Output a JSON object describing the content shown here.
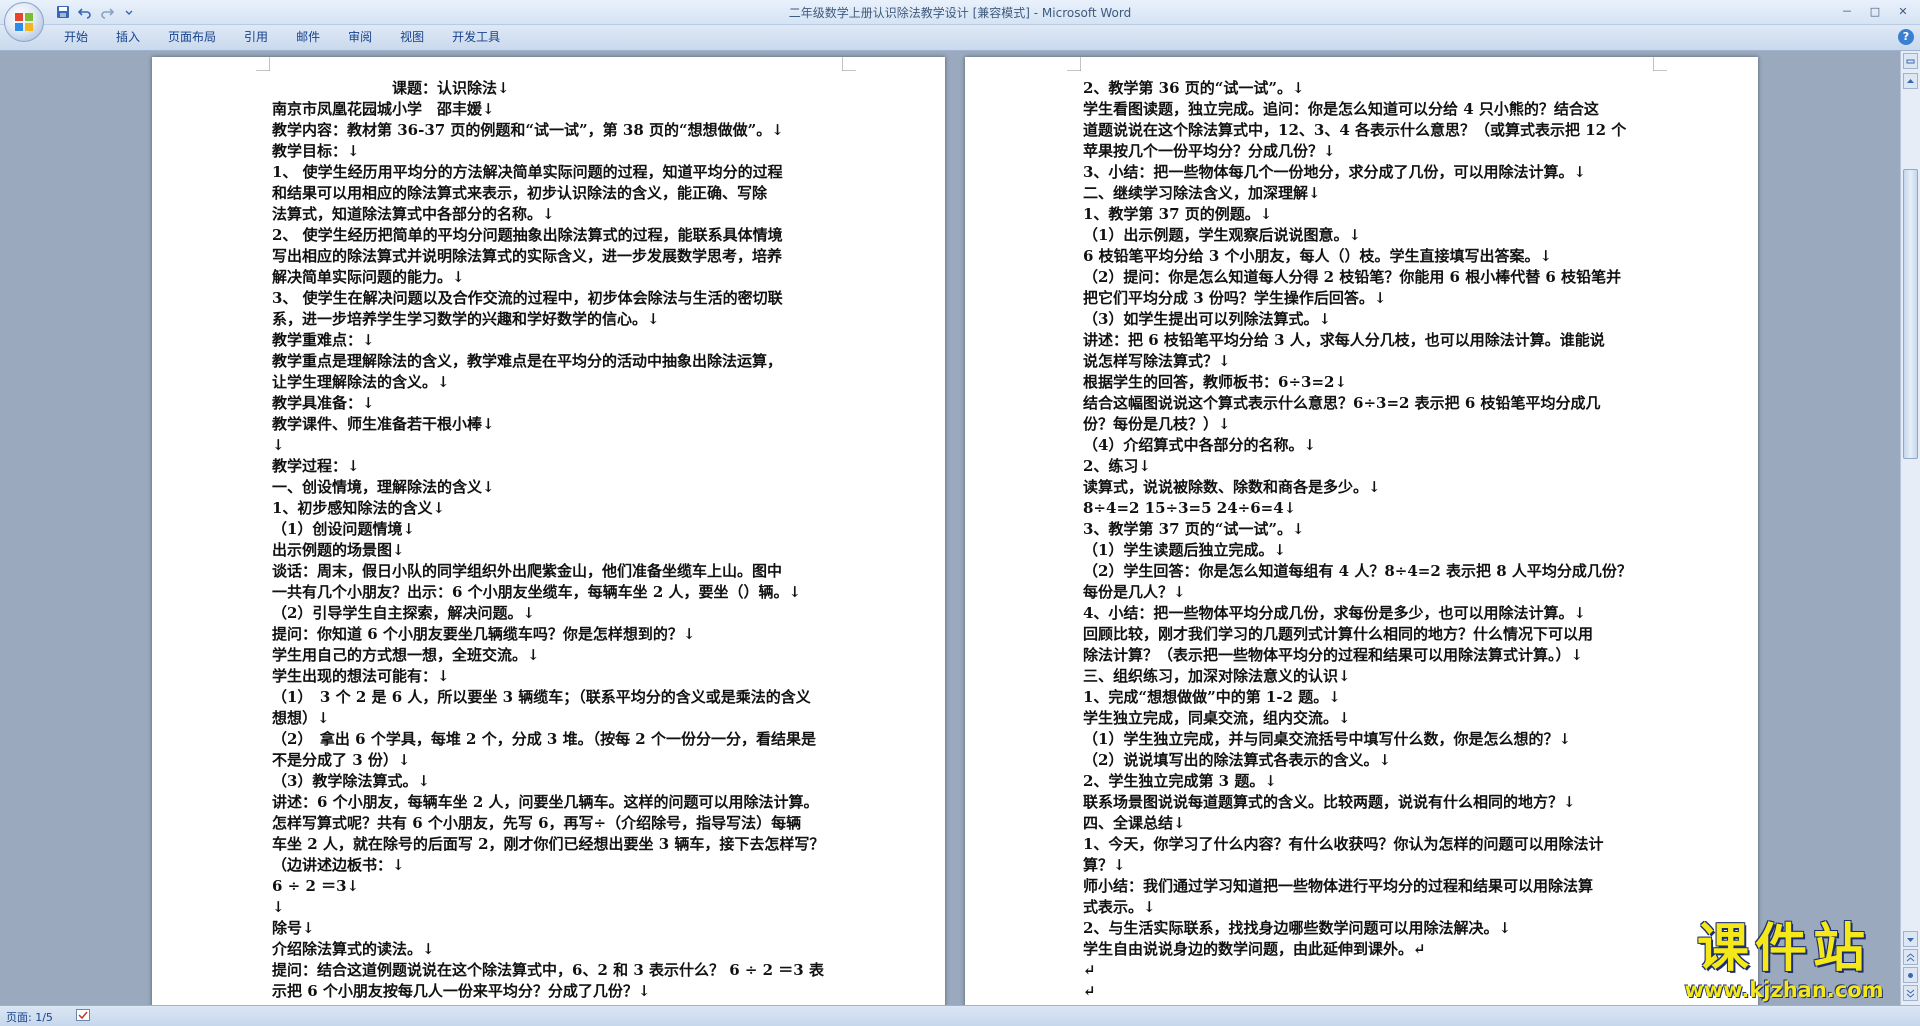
{
  "window": {
    "title": "二年级数学上册认识除法教学设计 [兼容模式] - Microsoft Word",
    "controls": [
      "－",
      "□",
      "✕"
    ]
  },
  "ribbon": {
    "tabs": [
      "开始",
      "插入",
      "页面布局",
      "引用",
      "邮件",
      "审阅",
      "视图",
      "开发工具"
    ],
    "help": "?"
  },
  "page1_lines": [
    "　　　　　　　　课题：认识除法↓",
    "南京市凤凰花园城小学　邵丰媛↓",
    "教学内容：教材第 36-37 页的例题和“试一试”，第 38 页的“想想做做”。↓",
    "教学目标：↓",
    "1、 使学生经历用平均分的方法解决简单实际问题的过程，知道平均分的过程",
    "和结果可以用相应的除法算式来表示，初步认识除法的含义，能正确、写除",
    "法算式，知道除法算式中各部分的名称。↓",
    "2、 使学生经历把简单的平均分问题抽象出除法算式的过程，能联系具体情境",
    "写出相应的除法算式并说明除法算式的实际含义，进一步发展数学思考，培养",
    "解决简单实际问题的能力。↓",
    "3、 使学生在解决问题以及合作交流的过程中，初步体会除法与生活的密切联",
    "系，进一步培养学生学习数学的兴趣和学好数学的信心。↓",
    "教学重难点：↓",
    "教学重点是理解除法的含义，教学难点是在平均分的活动中抽象出除法运算，",
    "让学生理解除法的含义。↓",
    "教学具准备：↓",
    "教学课件、师生准备若干根小棒↓",
    "↓",
    "教学过程：↓",
    "一、创设情境，理解除法的含义↓",
    "1、初步感知除法的含义↓",
    "（1）创设问题情境↓",
    "出示例题的场景图↓",
    "谈话：周末，假日小队的同学组织外出爬紫金山，他们准备坐缆车上山。图中",
    "一共有几个小朋友？出示：6 个小朋友坐缆车，每辆车坐 2 人，要坐（）辆。↓",
    "（2）引导学生自主探索，解决问题。↓",
    "提问：你知道 6 个小朋友要坐几辆缆车吗？你是怎样想到的？↓",
    "学生用自己的方式想一想，全班交流。↓",
    "学生出现的想法可能有：↓",
    "（1）　3 个 2 是 6 人，所以要坐 3 辆缆车；（联系平均分的含义或是乘法的含义",
    "想想）↓",
    "（2）　拿出 6 个学具，每堆 2 个，分成 3 堆。（按每 2 个一份分一分，看结果是",
    "不是分成了 3 份）↓",
    "（3）教学除法算式。↓",
    "讲述：6 个小朋友，每辆车坐 2 人，问要坐几辆车。这样的问题可以用除法计算。",
    "怎样写算式呢？共有 6 个小朋友，先写 6，再写÷（介绍除号，指导写法）每辆",
    "车坐 2 人，就在除号的后面写 2，刚才你们已经想出要坐 3 辆车，接下去怎样写？",
    "（边讲述边板书：↓",
    "6 ÷ 2 ＝3↓",
    "↓",
    "除号↓",
    "介绍除法算式的读法。↓",
    "提问：结合这道例题说说在这个除法算式中，6、2 和 3 表示什么？ 6 ÷ 2 ＝3 表",
    "示把 6 个小朋友按每几人一份来平均分？分成了几份？↓"
  ],
  "page2_lines": [
    "2、教学第 36 页的“试一试”。↓",
    "学生看图读题，独立完成。追问：你是怎么知道可以分给 4 只小熊的？结合这",
    "道题说说在这个除法算式中，12、3、4 各表示什么意思？（或算式表示把 12 个",
    "苹果按几个一份平均分？分成几份？↓",
    "3、小结：把一些物体每几个一份地分，求分成了几份，可以用除法计算。↓",
    "二、继续学习除法含义，加深理解↓",
    "1、教学第 37 页的例题。↓",
    "（1）出示例题，学生观察后说说图意。↓",
    "6 枝铅笔平均分给 3 个小朋友，每人（）枝。学生直接填写出答案。↓",
    "（2）提问：你是怎么知道每人分得 2 枝铅笔？你能用 6 根小棒代替 6 枝铅笔并",
    "把它们平均分成 3 份吗？学生操作后回答。↓",
    "（3）如学生提出可以列除法算式。↓",
    "讲述：把 6 枝铅笔平均分给 3 人，求每人分几枝，也可以用除法计算。谁能说",
    "说怎样写除法算式？↓",
    "根据学生的回答，教师板书：6÷3=2↓",
    "结合这幅图说说这个算式表示什么意思？6÷3=2 表示把 6 枝铅笔平均分成几",
    "份？每份是几枝？）↓",
    "（4）介绍算式中各部分的名称。↓",
    "2、练习↓",
    "读算式，说说被除数、除数和商各是多少。↓",
    "8÷4=2  15÷3=5   24÷6=4↓",
    "3、教学第 37 页的“试一试”。↓",
    "（1）学生读题后独立完成。↓",
    "（2）学生回答：你是怎么知道每组有 4 人？8÷4=2 表示把 8 人平均分成几份？",
    "每份是几人？↓",
    "4、小结：把一些物体平均分成几份，求每份是多少，也可以用除法计算。↓",
    "回顾比较，刚才我们学习的几题列式计算什么相同的地方？什么情况下可以用",
    "除法计算？（表示把一些物体平均分的过程和结果可以用除法算式计算。）↓",
    "三、组织练习，加深对除法意义的认识↓",
    "1、完成“想想做做”中的第 1-2 题。↓",
    "学生独立完成，同桌交流，组内交流。↓",
    "（1）学生独立完成，并与同桌交流括号中填写什么数，你是怎么想的？↓",
    "（2）说说填写出的除法算式各表示的含义。↓",
    "2、学生独立完成第 3 题。↓",
    "联系场景图说说每道题算式的含义。比较两题，说说有什么相同的地方？↓",
    "四、全课总结↓",
    "1、今天，你学习了什么内容？有什么收获吗？你认为怎样的问题可以用除法计",
    "算？↓",
    "师小结：我们通过学习知道把一些物体进行平均分的过程和结果可以用除法算",
    "式表示。↓",
    "2、与生活实际联系，找找身边哪些数学问题可以用除法解决。↓",
    "学生自由说说身边的数学问题，由此延伸到课外。↵",
    "↵",
    "↵"
  ],
  "status": {
    "page": "页面: 1/5"
  },
  "watermark": {
    "cn": "课件站",
    "url": "www.kjzhan.com"
  },
  "colors": {
    "ribbon_text": "#15428b",
    "workspace": "#9aa9bd",
    "watermark": "#f4e81a"
  }
}
